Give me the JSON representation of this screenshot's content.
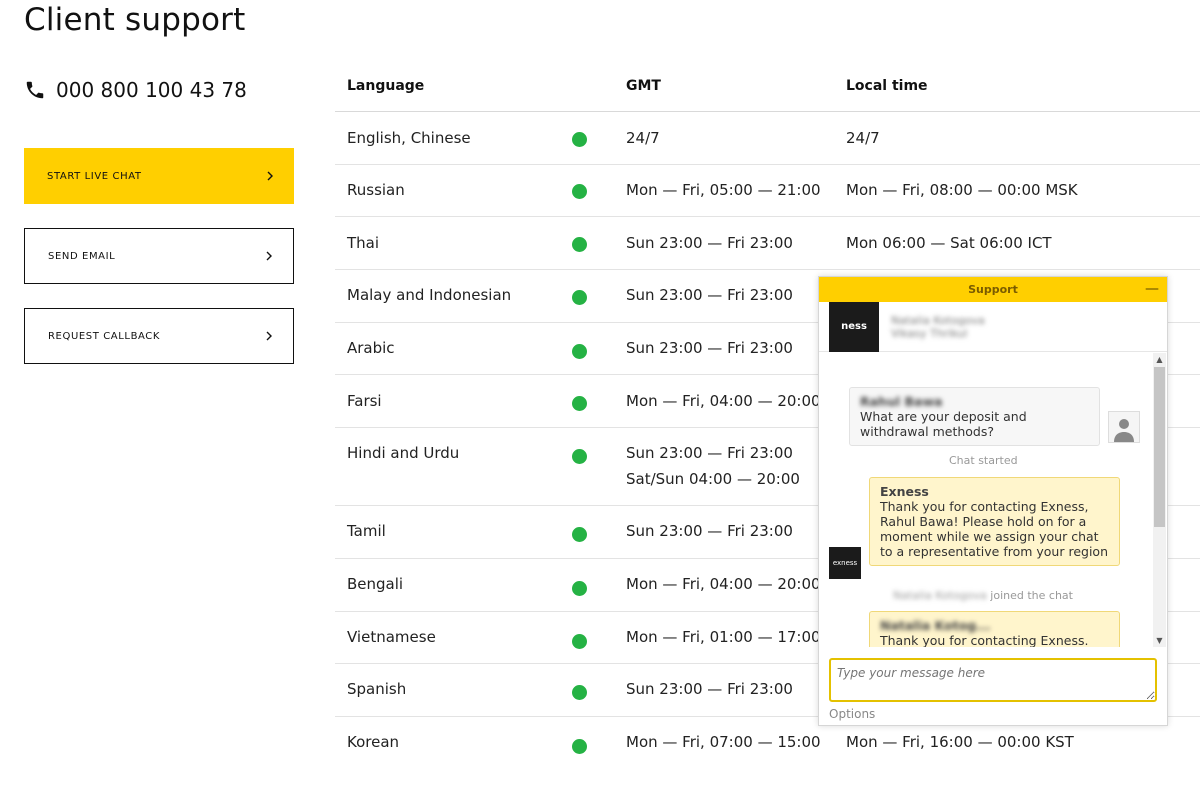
{
  "page": {
    "title": "Client support"
  },
  "contact": {
    "phone": "000 800 100 43 78"
  },
  "actions": [
    {
      "label": "START LIVE CHAT",
      "style": "primary"
    },
    {
      "label": "SEND EMAIL",
      "style": "outline"
    },
    {
      "label": "REQUEST CALLBACK",
      "style": "outline"
    }
  ],
  "table": {
    "headers": {
      "language": "Language",
      "gmt": "GMT",
      "local": "Local time"
    },
    "rows": [
      {
        "language": "English, Chinese",
        "gmt": [
          "24/7"
        ],
        "local": "24/7",
        "status": "online"
      },
      {
        "language": "Russian",
        "gmt": [
          "Mon — Fri, 05:00 — 21:00"
        ],
        "local": "Mon — Fri, 08:00 — 00:00 MSK",
        "status": "online"
      },
      {
        "language": "Thai",
        "gmt": [
          "Sun 23:00 — Fri 23:00"
        ],
        "local": "Mon 06:00 — Sat 06:00 ICT",
        "status": "online"
      },
      {
        "language": "Malay and Indonesian",
        "gmt": [
          "Sun 23:00 — Fri 23:00"
        ],
        "local": "",
        "status": "online"
      },
      {
        "language": "Arabic",
        "gmt": [
          "Sun 23:00 — Fri 23:00"
        ],
        "local": "",
        "status": "online"
      },
      {
        "language": "Farsi",
        "gmt": [
          "Mon — Fri, 04:00 — 20:00"
        ],
        "local": "",
        "status": "online"
      },
      {
        "language": "Hindi and Urdu",
        "gmt": [
          "Sun 23:00 — Fri 23:00",
          "Sat/Sun 04:00 — 20:00"
        ],
        "local": "",
        "status": "online"
      },
      {
        "language": "Tamil",
        "gmt": [
          "Sun 23:00 — Fri 23:00"
        ],
        "local": "",
        "status": "online"
      },
      {
        "language": "Bengali",
        "gmt": [
          "Mon — Fri, 04:00 — 20:00"
        ],
        "local": "",
        "status": "online"
      },
      {
        "language": "Vietnamese",
        "gmt": [
          "Mon — Fri, 01:00 — 17:00"
        ],
        "local": "",
        "status": "online"
      },
      {
        "language": "Spanish",
        "gmt": [
          "Sun 23:00 — Fri 23:00"
        ],
        "local": "",
        "status": "online"
      },
      {
        "language": "Korean",
        "gmt": [
          "Mon — Fri, 07:00 — 15:00"
        ],
        "local": "Mon — Fri, 16:00 — 00:00 KST",
        "status": "online"
      }
    ]
  },
  "chat": {
    "title": "Support",
    "agent_logo_text": "ness",
    "agent_name": "Natalia Kotogova",
    "agent_role": "Vikasy Thrikul",
    "messages": {
      "user_name": "Rahul Bawa",
      "user_text": "What are your deposit and withdrawal methods?",
      "chat_started": "Chat started",
      "agent1_name": "Exness",
      "agent1_text": "Thank you for contacting Exness, Rahul Bawa! Please hold on for a moment while we assign your chat to a representative from your region",
      "joined_name": "Natalia Kotogova",
      "joined_text": "joined the chat",
      "agent2_name": "Natalia Kotog...",
      "agent2_text": "Thank you for contacting Exness."
    },
    "avatar_logo_text": "exness",
    "input_placeholder": "Type your message here",
    "options_label": "Options"
  },
  "colors": {
    "accent": "#ffcf00",
    "status_online": "#25b244"
  }
}
